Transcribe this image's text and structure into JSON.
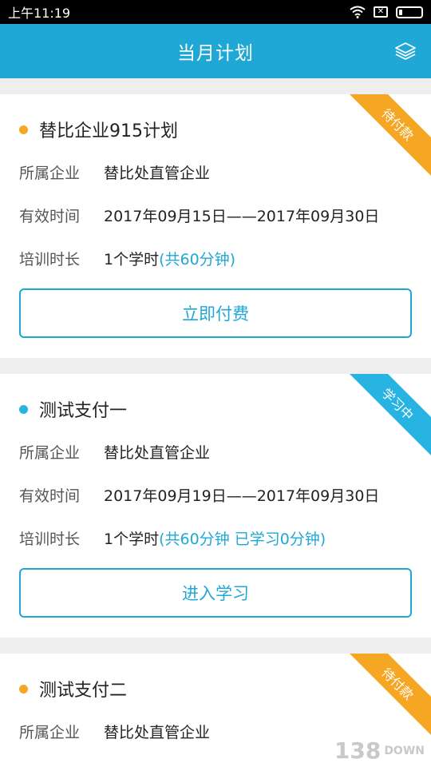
{
  "status_bar": {
    "time": "上午11:19",
    "sim_symbol": "✕"
  },
  "header": {
    "title": "当月计划",
    "right_icon": "layers-icon"
  },
  "colors": {
    "accent": "#1fa8d6",
    "pending": "#f5a623",
    "learning": "#27b4e3"
  },
  "labels": {
    "company": "所属企业",
    "valid_time": "有效时间",
    "duration": "培训时长"
  },
  "plans": [
    {
      "title": "替比企业915计划",
      "badge": "待付款",
      "company": "替比处直管企业",
      "valid_time": "2017年09月15日——2017年09月30日",
      "duration": "1个学时",
      "duration_extra": "(共60分钟)",
      "button": "立即付费"
    },
    {
      "title": "测试支付一",
      "badge": "学习中",
      "company": "替比处直管企业",
      "valid_time": "2017年09月19日——2017年09月30日",
      "duration": "1个学时",
      "duration_extra": "(共60分钟  已学习0分钟)",
      "button": "进入学习"
    },
    {
      "title": "测试支付二",
      "badge": "待付款",
      "company": "替比处直管企业"
    }
  ],
  "watermark": {
    "text": "138",
    "sub": "DOWN"
  }
}
